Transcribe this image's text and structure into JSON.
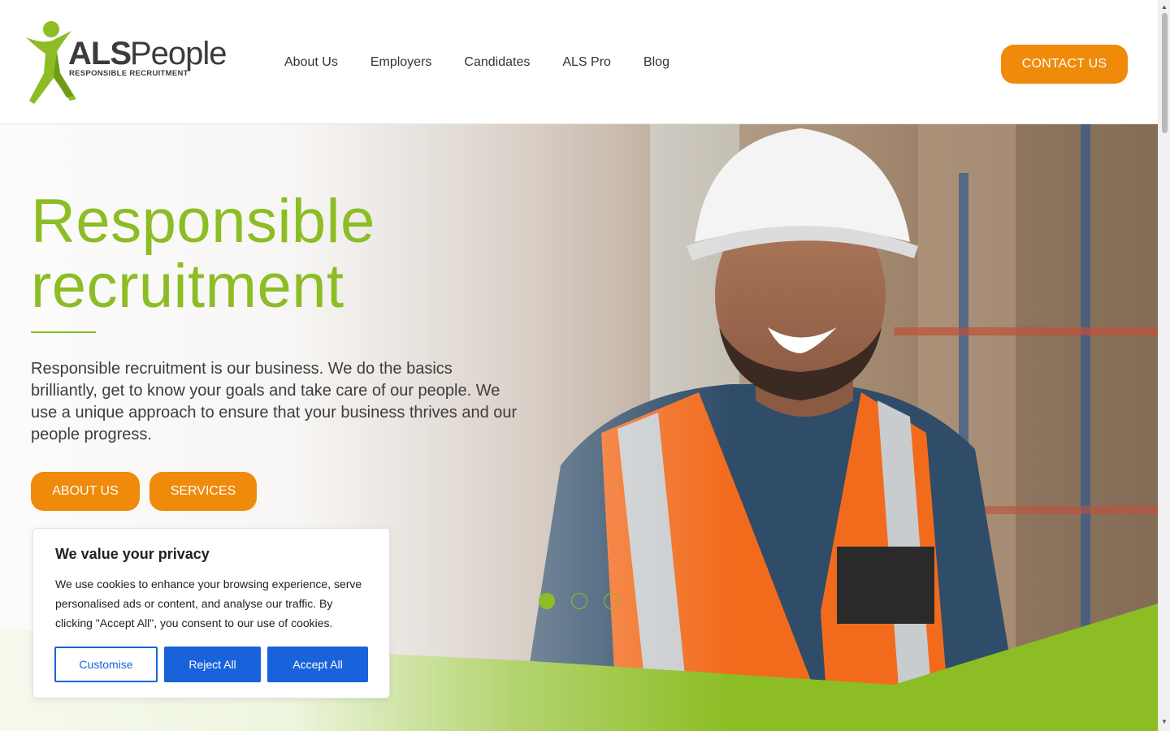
{
  "header": {
    "logo_brand": "ALS",
    "logo_name": "People",
    "logo_tagline": "RESPONSIBLE RECRUITMENT",
    "nav": [
      "About Us",
      "Employers",
      "Candidates",
      "ALS Pro",
      "Blog"
    ],
    "contact_label": "CONTACT US"
  },
  "hero": {
    "title_line1": "Responsible",
    "title_line2": "recruitment",
    "description": "Responsible recruitment is our business. We do the basics brilliantly, get to know your goals and take care of our people. We use a unique approach to ensure that your business thrives and our people progress.",
    "about_button": "ABOUT US",
    "services_button": "SERVICES",
    "slide_count": 3,
    "active_slide": 1
  },
  "cookie_banner": {
    "title": "We value your privacy",
    "text": "We use cookies to enhance your browsing experience, serve personalised ads or content, and analyse our traffic. By clicking \"Accept All\", you consent to our use of cookies.",
    "customise_label": "Customise",
    "reject_label": "Reject All",
    "accept_label": "Accept All"
  },
  "colors": {
    "brand_green": "#8cbd24",
    "brand_orange": "#ef8a0a",
    "cookie_blue": "#1863dc"
  }
}
